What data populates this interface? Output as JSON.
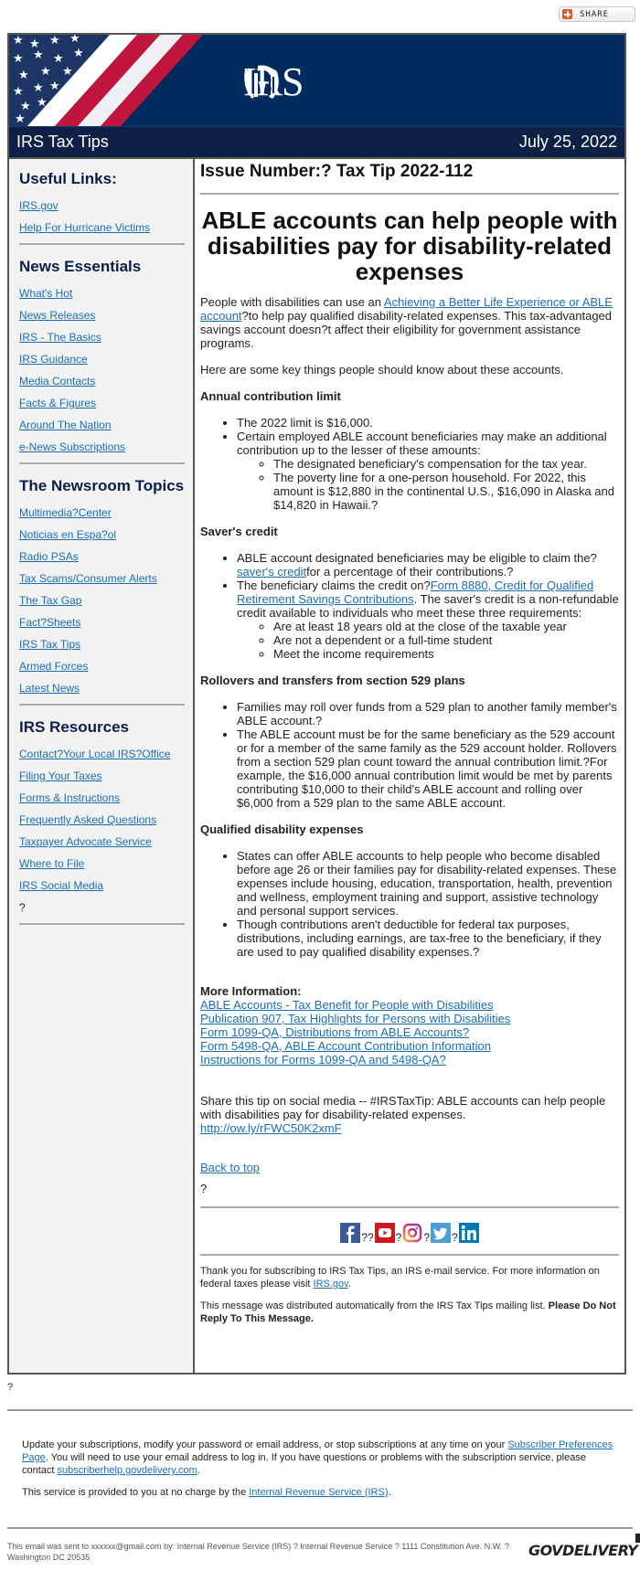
{
  "share": {
    "label": "SHARE",
    "icon": "plus-icon"
  },
  "banner": {
    "logo_text": "IRS",
    "seal_icon": "irs-eagle-seal-icon",
    "flag": "american-flag-graphic"
  },
  "titlebar": {
    "title": "IRS Tax Tips",
    "date": "July 25, 2022"
  },
  "sidebar": {
    "sections": [
      {
        "title": "Useful Links:",
        "items": [
          "IRS.gov",
          "Help For Hurricane Victims"
        ]
      },
      {
        "title": "News Essentials",
        "items": [
          "What's Hot",
          "News Releases",
          "IRS - The Basics",
          "IRS Guidance",
          "Media Contacts",
          "Facts & Figures",
          "Around The Nation",
          "e-News Subscriptions"
        ]
      },
      {
        "title": "The Newsroom Topics",
        "items": [
          "Multimedia?Center",
          "Noticias en Espa?ol",
          "Radio PSAs",
          "Tax Scams/Consumer Alerts",
          "The Tax Gap",
          "Fact?Sheets",
          "IRS Tax Tips",
          "Armed Forces",
          "Latest News"
        ]
      },
      {
        "title": "IRS Resources",
        "items": [
          "Contact?Your Local IRS?Office",
          "Filing Your Taxes",
          "Forms & Instructions",
          "Frequently Asked Questions",
          "Taxpayer Advocate Service",
          "Where to File",
          "IRS Social Media"
        ],
        "trailing": "?"
      }
    ]
  },
  "main": {
    "issue": "Issue Number:? Tax Tip 2022-112",
    "headline": "ABLE accounts can help people with disabilities pay for disability-related expenses",
    "intro": {
      "before": "People with disabilities can use an ",
      "link": "Achieving a Better Life Experience or ABLE account",
      "after": "?to help pay qualified disability-related expenses. This tax-advantaged savings account doesn?t affect their eligibility for government assistance programs."
    },
    "key_things": "Here are some key things people should know about these accounts.",
    "sections": {
      "annual": {
        "title": "Annual contribution limit",
        "b1": "The 2022 limit is $16,000.",
        "b2": "Certain employed ABLE account beneficiaries may make an additional contribution up to the lesser of these amounts:",
        "s1": "The designated beneficiary's compensation for the tax year.",
        "s2": "The poverty line for a one-person household. For 2022, this amount is $12,880 in the continental U.S., $16,090 in Alaska and $14,820 in Hawaii.?"
      },
      "savers": {
        "title": "Saver's credit",
        "b1_before": "ABLE account designated beneficiaries may be eligible to claim the? ",
        "b1_link": "saver's credit",
        "b1_after": "for a percentage of their contributions.?",
        "b2_before": "The beneficiary claims the credit on?",
        "b2_link": "Form 8880, Credit for Qualified Retirement Savings Contributions",
        "b2_after": ". The saver's credit is a non-refundable credit available to individuals who meet these three requirements:",
        "s1": "Are at least 18 years old at the close of the taxable year",
        "s2": "Are not a dependent or a full-time student",
        "s3": "Meet the income requirements"
      },
      "rollovers": {
        "title": "Rollovers and transfers from section 529 plans",
        "b1": "Families may roll over funds from a 529 plan to another family member's ABLE account.?",
        "b2": "The ABLE account must be for the same beneficiary as the 529 account or for a member of the same family as the 529 account holder. Rollovers from a section 529 plan count toward the annual contribution limit.?For example, the $16,000 annual contribution limit would be met by parents contributing $10,000 to their child's ABLE account and rolling over $6,000 from a 529 plan to the same ABLE account."
      },
      "qualified": {
        "title": "Qualified disability expenses",
        "b1": "States can offer ABLE accounts to help people who become disabled before age 26 or their families pay for disability-related expenses. These expenses include housing, education, transportation, health, prevention and wellness, employment training and support, assistive technology and personal support services.",
        "b2": "Though contributions aren't deductible for federal tax purposes, distributions, including earnings, are tax-free to the beneficiary, if they are used to pay qualified disability expenses.?"
      }
    },
    "more_info": {
      "title": "More Information:",
      "links": [
        "ABLE Accounts - Tax Benefit for People with Disabilities",
        "Publication 907, Tax Highlights for Persons with Disabilities",
        "Form 1099-QA, Distributions from ABLE Accounts?",
        "Form 5498-QA, ABLE Account Contribution Information",
        "Instructions for Forms 1099-QA and 5498-QA?"
      ]
    },
    "share_tip": "Share this tip on social media -- #IRSTaxTip: ABLE accounts can help people with disabilities pay for disability-related expenses.",
    "share_link": "http://ow.ly/rFWC50K2xmF",
    "back_to_top": "Back to top",
    "placeholder_q": "?",
    "social": {
      "separators": [
        "??",
        "?",
        "?",
        "?"
      ],
      "icons": [
        "facebook-icon",
        "youtube-icon",
        "instagram-icon",
        "twitter-icon",
        "linkedin-icon"
      ]
    },
    "thanks_before": "Thank you for subscribing to IRS Tax Tips, an IRS e-mail service. For more information on federal taxes please visit ",
    "thanks_link": "IRS.gov",
    "thanks_after": ".",
    "auto_msg": "This message was distributed automatically from the IRS Tax Tips mailing list. ",
    "auto_msg_bold": "Please Do Not Reply To This Message."
  },
  "footer": {
    "q": "?",
    "update_before": "Update your subscriptions, modify your password or email address, or stop subscriptions at any time on your ",
    "update_link": "Subscriber Preferences Page",
    "update_middle": ". You will need to use your email address to log in. If you have questions or problems with the subscription service, please contact ",
    "help_link": "subscriberhelp.govdelivery.com",
    "update_after": ".",
    "service_before": "This service is provided to you at no charge by the ",
    "service_link": "Internal Revenue Service (IRS)",
    "service_after": ".",
    "sent_to": "This email was sent to xxxxxx@gmail.com by: Internal Revenue Service (IRS) ? Internal Revenue Service ? 1111 Constitution Ave. N.W. ? Washington DC 20535",
    "brand": "GOVDELIVERY"
  },
  "colors": {
    "navy": "#002b5f",
    "titlebar": "#0c2145",
    "link": "#1a6eb5",
    "sidebar_bg": "#f2f2f2",
    "flag_red": "#c0153c"
  }
}
